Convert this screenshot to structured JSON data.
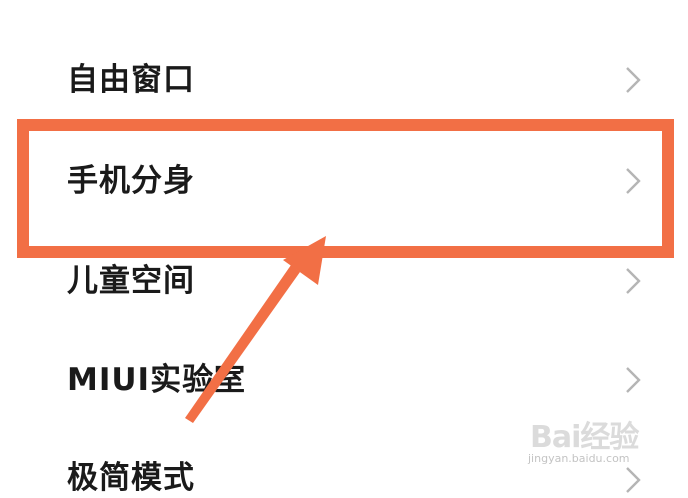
{
  "settings": {
    "items": [
      {
        "label": "自由窗口",
        "chevron": "chevron-right-icon"
      },
      {
        "label": "手机分身",
        "chevron": "chevron-right-icon"
      },
      {
        "label": "儿童空间",
        "chevron": "chevron-right-icon"
      },
      {
        "label": "MIUI实验室",
        "chevron": "chevron-right-icon"
      },
      {
        "label": "极简模式",
        "chevron": "chevron-right-icon"
      }
    ],
    "highlighted_item": "手机分身"
  },
  "annotation": {
    "highlight_color": "#f26f45",
    "arrow_color": "#f26f45"
  },
  "watermark": {
    "brand": "Bai经验",
    "url": "jingyan.baidu.com"
  }
}
